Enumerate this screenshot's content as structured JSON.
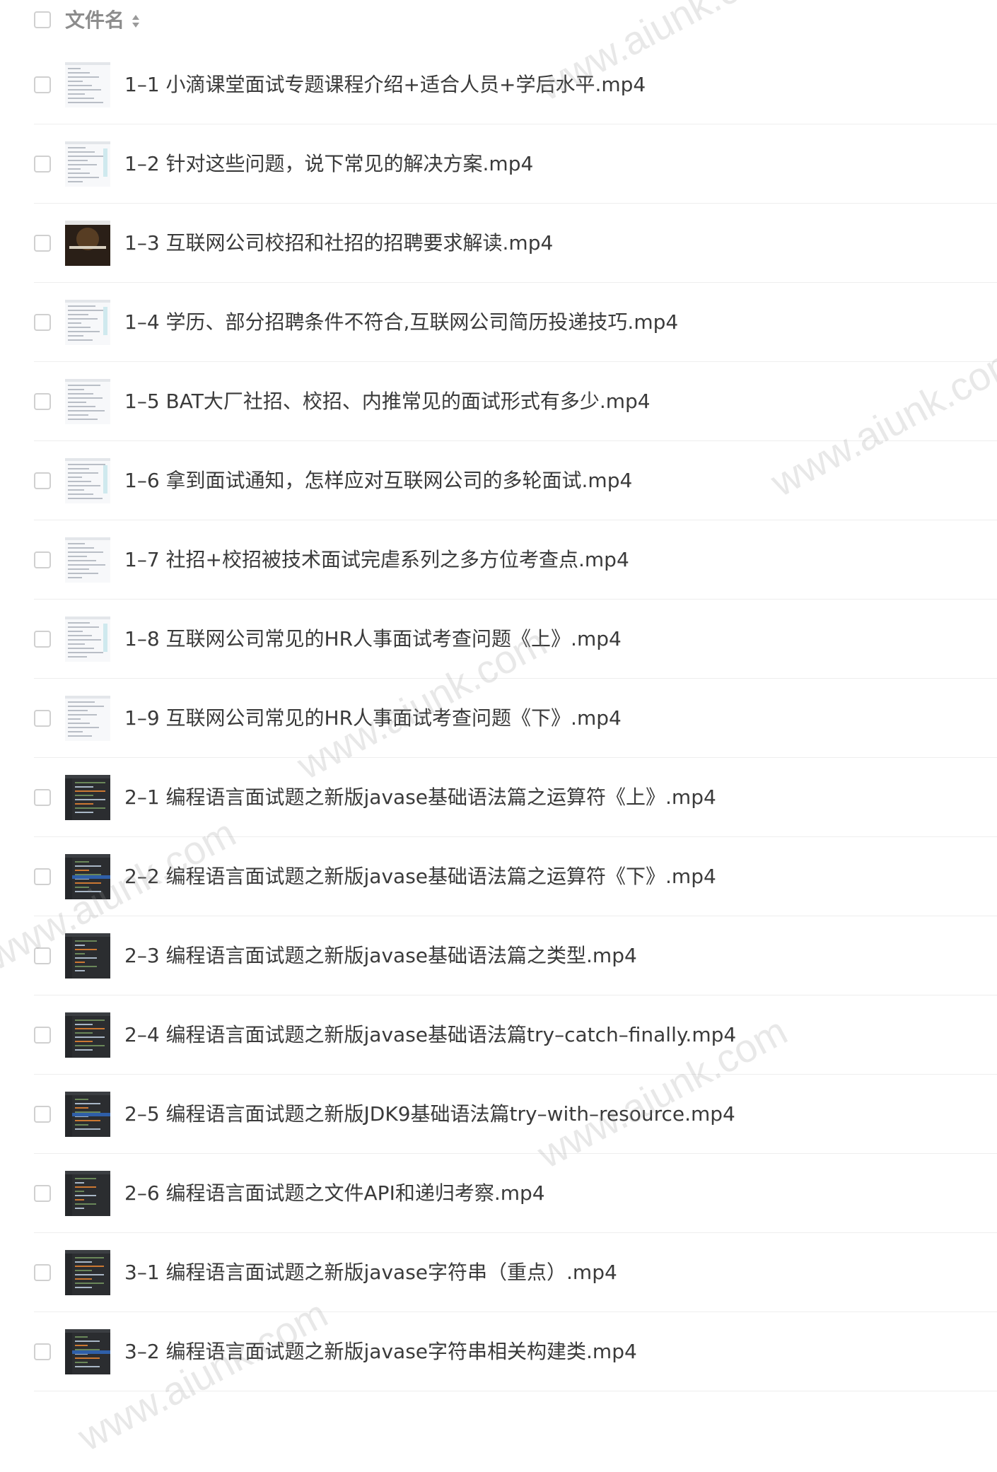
{
  "header": {
    "title": "文件名",
    "sort_icon": "sort-updown-icon"
  },
  "files": [
    {
      "name": "1–1 小滴课堂面试专题课程介绍+适合人员+学后水平.mp4",
      "thumb": "light"
    },
    {
      "name": "1–2 针对这些问题，说下常见的解决方案.mp4",
      "thumb": "light"
    },
    {
      "name": "1–3 互联网公司校招和社招的招聘要求解读.mp4",
      "thumb": "dark-photo"
    },
    {
      "name": "1–4 学历、部分招聘条件不符合,互联网公司简历投递技巧.mp4",
      "thumb": "light"
    },
    {
      "name": "1–5 BAT大厂社招、校招、内推常见的面试形式有多少.mp4",
      "thumb": "light"
    },
    {
      "name": "1–6 拿到面试通知，怎样应对互联网公司的多轮面试.mp4",
      "thumb": "light"
    },
    {
      "name": "1–7 社招+校招被技术面试完虐系列之多方位考查点.mp4",
      "thumb": "light"
    },
    {
      "name": "1–8 互联网公司常见的HR人事面试考查问题《上》.mp4",
      "thumb": "light"
    },
    {
      "name": "1–9 互联网公司常见的HR人事面试考查问题《下》.mp4",
      "thumb": "light"
    },
    {
      "name": "2–1 编程语言面试题之新版javase基础语法篇之运算符《上》.mp4",
      "thumb": "dark-code"
    },
    {
      "name": "2–2 编程语言面试题之新版javase基础语法篇之运算符《下》.mp4",
      "thumb": "dark-code"
    },
    {
      "name": "2–3 编程语言面试题之新版javase基础语法篇之类型.mp4",
      "thumb": "dark-code"
    },
    {
      "name": "2–4 编程语言面试题之新版javase基础语法篇try–catch–finally.mp4",
      "thumb": "dark-code"
    },
    {
      "name": "2–5 编程语言面试题之新版JDK9基础语法篇try–with–resource.mp4",
      "thumb": "dark-code"
    },
    {
      "name": "2–6 编程语言面试题之文件API和递归考察.mp4",
      "thumb": "dark-code"
    },
    {
      "name": "3–1 编程语言面试题之新版javase字符串（重点）.mp4",
      "thumb": "dark-code"
    },
    {
      "name": "3–2 编程语言面试题之新版javase字符串相关构建类.mp4",
      "thumb": "dark-code"
    }
  ],
  "watermark_text": "www.aiunk.com",
  "colors": {
    "text": "#3a3a3a",
    "header_text": "#8c8c8c",
    "checkbox_border": "#d0d0d0",
    "divider": "#eeeeee"
  }
}
